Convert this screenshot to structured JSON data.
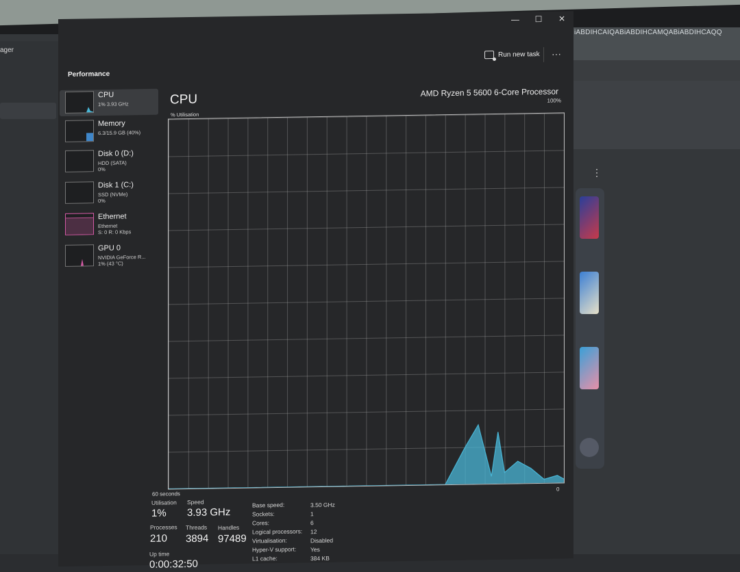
{
  "background": {
    "left_app_title": "ager",
    "right_bar_text": "iABDIHCAIQABiABDIHCAMQABiABDIHCAQQ",
    "right_menu_glyph": "⋮"
  },
  "window": {
    "caption_buttons": [
      "—",
      "☐",
      "✕"
    ],
    "section_title": "Performance",
    "run_new_task": "Run new task",
    "more_glyph": "···"
  },
  "sidebar": {
    "items": [
      {
        "name": "CPU",
        "sub1": "1% 3.93 GHz",
        "sub2": ""
      },
      {
        "name": "Memory",
        "sub1": "6.3/15.9 GB (40%)",
        "sub2": ""
      },
      {
        "name": "Disk 0 (D:)",
        "sub1": "HDD (SATA)",
        "sub2": "0%"
      },
      {
        "name": "Disk 1 (C:)",
        "sub1": "SSD (NVMe)",
        "sub2": "0%"
      },
      {
        "name": "Ethernet",
        "sub1": "Ethernet",
        "sub2": "S: 0 R: 0 Kbps"
      },
      {
        "name": "GPU 0",
        "sub1": "NVIDIA GeForce R...",
        "sub2": "1% (43 °C)"
      }
    ]
  },
  "main": {
    "title": "CPU",
    "model": "AMD Ryzen 5 5600 6-Core Processor",
    "y_axis_label": "% Utilisation",
    "y_max_label": "100%",
    "x_span_label": "60 seconds",
    "x_end_label": "0"
  },
  "chart_data": {
    "type": "area",
    "y_unit": "% Utilisation",
    "ylim": [
      0,
      100
    ],
    "x_range_seconds": [
      60,
      0
    ],
    "grid": true,
    "series": [
      {
        "color": "#49b6d6",
        "points_seconds_ago_and_percent": [
          [
            60,
            0
          ],
          [
            18,
            0
          ],
          [
            15,
            10
          ],
          [
            13,
            16
          ],
          [
            11,
            2
          ],
          [
            10,
            14
          ],
          [
            9,
            3
          ],
          [
            7,
            6
          ],
          [
            5,
            4
          ],
          [
            3,
            1
          ],
          [
            1,
            2
          ],
          [
            0,
            1
          ]
        ]
      }
    ]
  },
  "stats": {
    "utilisation_label": "Utilisation",
    "utilisation_value": "1%",
    "speed_label": "Speed",
    "speed_value": "3.93 GHz",
    "processes_label": "Processes",
    "processes_value": "210",
    "threads_label": "Threads",
    "threads_value": "3894",
    "handles_label": "Handles",
    "handles_value": "97489",
    "uptime_label": "Up time",
    "uptime_value": "0:00:32:50"
  },
  "details": [
    {
      "label": "Base speed:",
      "value": "3.50 GHz"
    },
    {
      "label": "Sockets:",
      "value": "1"
    },
    {
      "label": "Cores:",
      "value": "6"
    },
    {
      "label": "Logical processors:",
      "value": "12"
    },
    {
      "label": "Virtualisation:",
      "value": "Disabled"
    },
    {
      "label": "Hyper-V support:",
      "value": "Yes"
    },
    {
      "label": "L1 cache:",
      "value": "384 KB"
    }
  ],
  "colors": {
    "cpu_graph": "#49b6d6",
    "ethernet_graph": "#d45aa5",
    "memory_graph": "#3f86c9"
  }
}
